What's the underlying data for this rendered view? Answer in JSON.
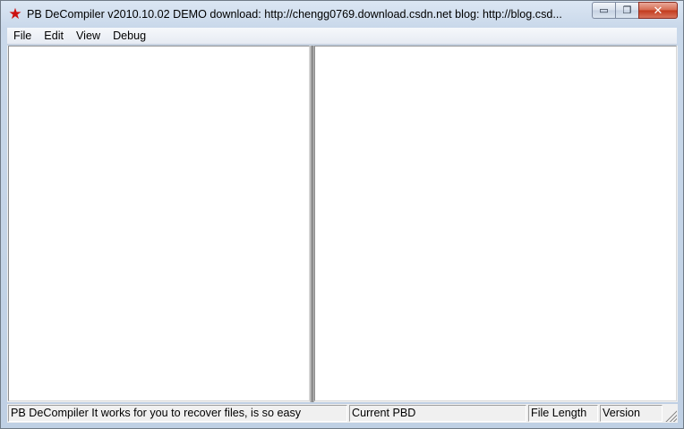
{
  "window": {
    "title": "PB DeCompiler v2010.10.02 DEMO download: http://chengg0769.download.csdn.net  blog: http://blog.csd...",
    "icon": "red-star-icon"
  },
  "caption_buttons": {
    "minimize": "▭",
    "restore": "❐",
    "close": "✕"
  },
  "menu": {
    "items": [
      "File",
      "Edit",
      "View",
      "Debug"
    ]
  },
  "statusbar": {
    "panels": [
      "PB DeCompiler   It works for you to recover files, is so easy",
      "Current PBD",
      "File Length",
      "Version"
    ]
  },
  "colors": {
    "title_icon": "#cc1111",
    "frame": "#c9d8ea",
    "close_button": "#c2391c"
  }
}
